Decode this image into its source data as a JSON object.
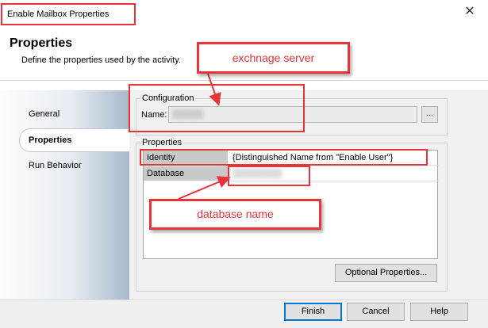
{
  "window": {
    "title": "Enable Mailbox Properties",
    "close_icon": "close-icon"
  },
  "header": {
    "title": "Properties",
    "subtitle": "Define the properties used by the activity."
  },
  "sidebar": {
    "items": [
      {
        "label": "General"
      },
      {
        "label": "Properties",
        "selected": true
      },
      {
        "label": "Run Behavior"
      }
    ]
  },
  "configuration": {
    "group_label": "Configuration",
    "name_label": "Name:",
    "name_value": "▒▒▒▒▒",
    "browse_label": "..."
  },
  "properties": {
    "group_label": "Properties",
    "rows": [
      {
        "name": "Identity",
        "value": "{Distinguished Name from \"Enable User\"}"
      },
      {
        "name": "Database",
        "value": "▒▒▒▒▒▒▒▒"
      }
    ],
    "optional_button": "Optional Properties..."
  },
  "footer": {
    "finish": "Finish",
    "cancel": "Cancel",
    "help": "Help"
  },
  "annotations": {
    "exchange_callout": "exchnage server",
    "database_callout": "database name",
    "color": "#e8333a"
  }
}
